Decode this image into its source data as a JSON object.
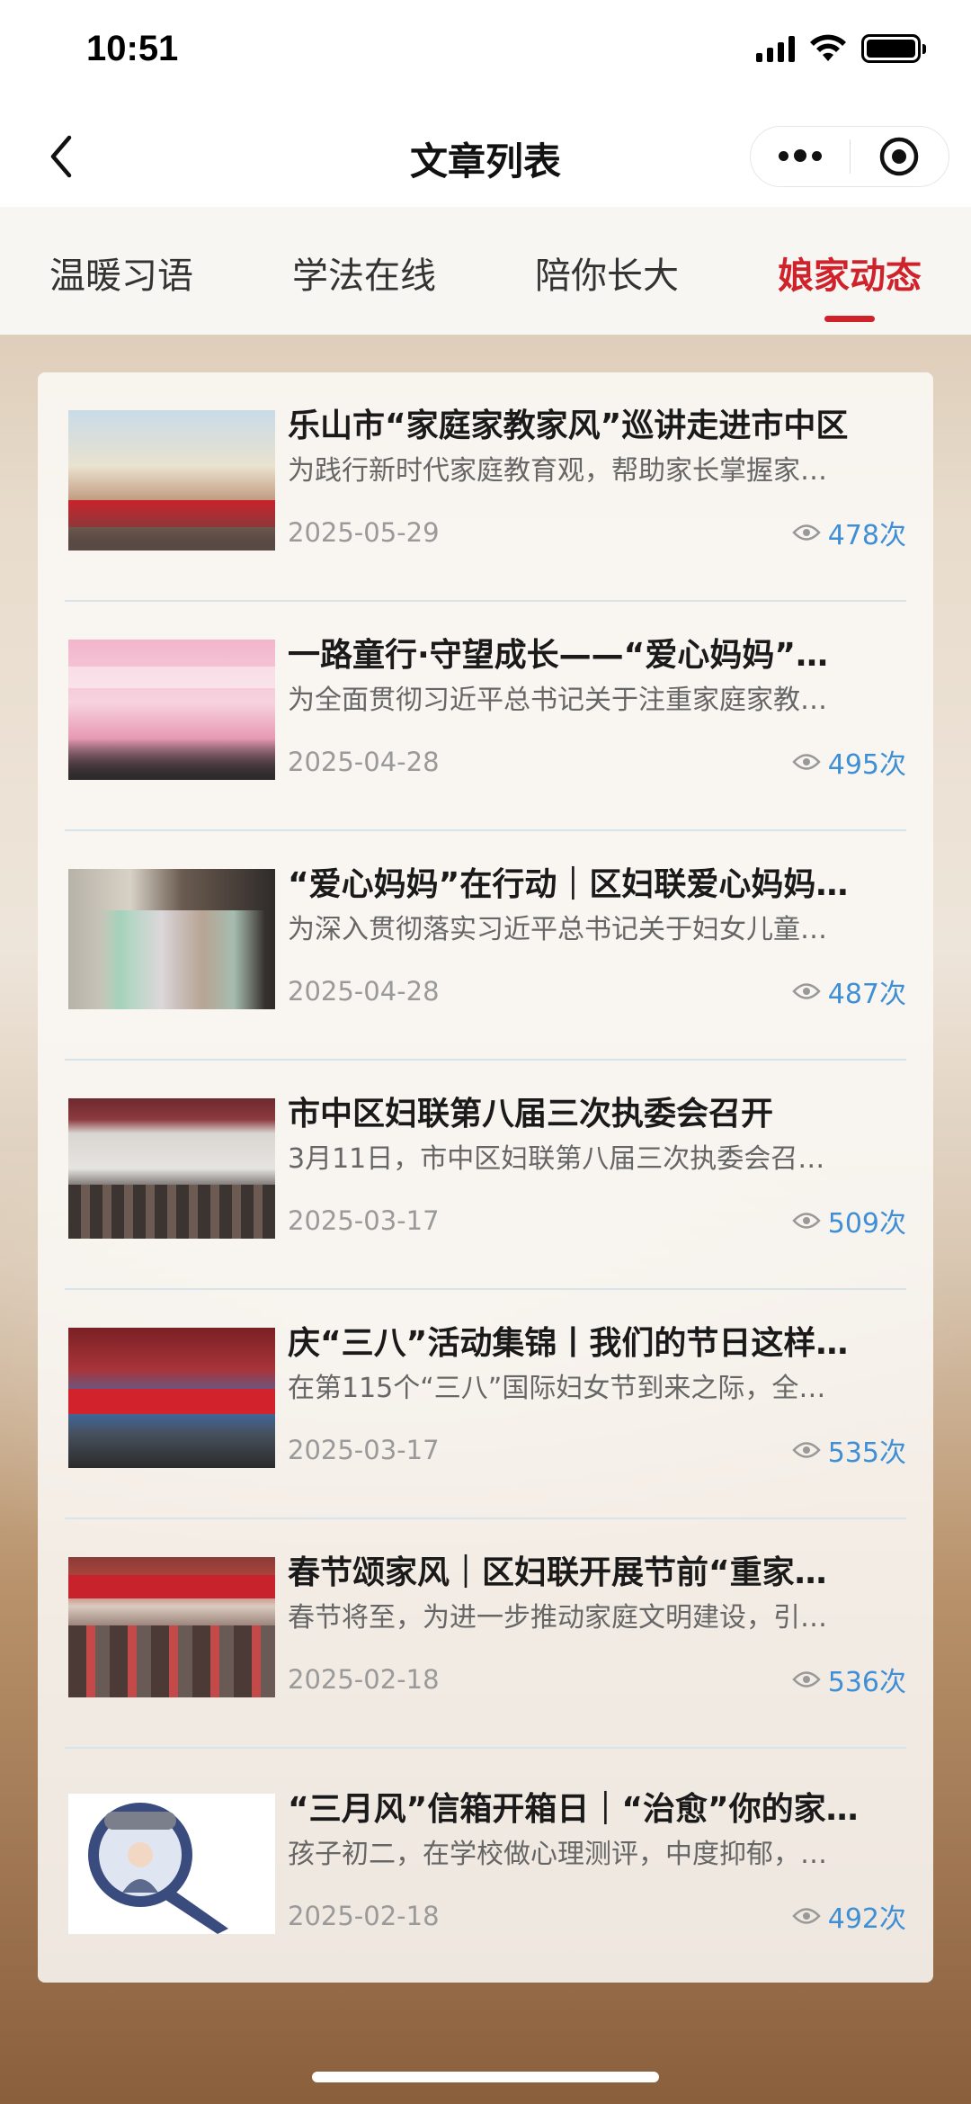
{
  "status_bar": {
    "time": "10:51"
  },
  "nav": {
    "title": "文章列表"
  },
  "tabs": [
    {
      "label": "温暖习语",
      "active": false
    },
    {
      "label": "学法在线",
      "active": false
    },
    {
      "label": "陪你长大",
      "active": false
    },
    {
      "label": "娘家动态",
      "active": true
    }
  ],
  "colors": {
    "accent": "#d0222a",
    "views": "#3f8fd6"
  },
  "articles": [
    {
      "title": "乐山市“家庭家教家风”巡讲走进市中区",
      "summary": "为践行新时代家庭教育观，帮助家长掌握家…",
      "date": "2025-05-29",
      "views": "478次"
    },
    {
      "title": "一路童行·守望成长——“爱心妈妈”…",
      "summary": "为全面贯彻习近平总书记关于注重家庭家教…",
      "date": "2025-04-28",
      "views": "495次"
    },
    {
      "title": "“爱心妈妈”在行动｜区妇联爱心妈妈…",
      "summary": "为深入贯彻落实习近平总书记关于妇女儿童…",
      "date": "2025-04-28",
      "views": "487次"
    },
    {
      "title": "市中区妇联第八届三次执委会召开",
      "summary": "3月11日，市中区妇联第八届三次执委会召…",
      "date": "2025-03-17",
      "views": "509次"
    },
    {
      "title": "庆“三八”活动集锦丨我们的节日这样…",
      "summary": "在第115个“三八”国际妇女节到来之际，全…",
      "date": "2025-03-17",
      "views": "535次"
    },
    {
      "title": "春节颂家风｜区妇联开展节前“重家…",
      "summary": "春节将至，为进一步推动家庭文明建设，引…",
      "date": "2025-02-18",
      "views": "536次"
    },
    {
      "title": "“三月风”信箱开箱日｜“治愈”你的家…",
      "summary": "孩子初二，在学校做心理测评，中度抑郁，…",
      "date": "2025-02-18",
      "views": "492次"
    }
  ]
}
